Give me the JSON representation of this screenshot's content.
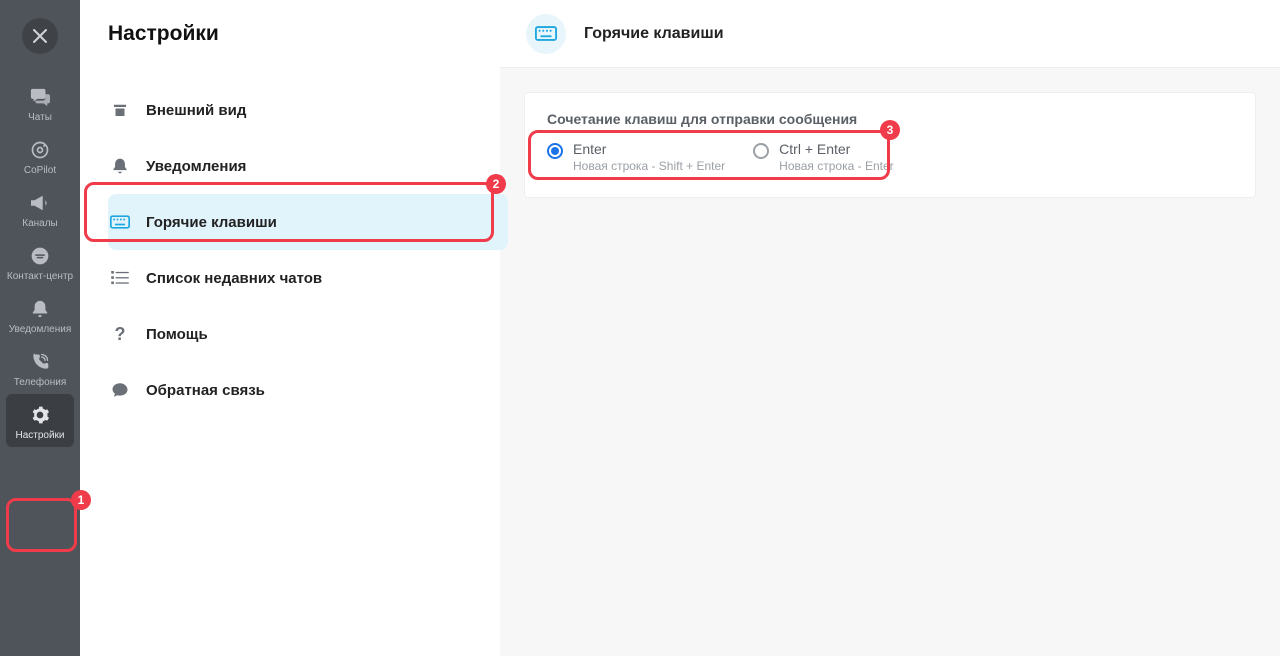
{
  "nav": {
    "items": [
      {
        "label": "Чаты"
      },
      {
        "label": "CoPilot"
      },
      {
        "label": "Каналы"
      },
      {
        "label": "Контакт-центр"
      },
      {
        "label": "Уведомления"
      },
      {
        "label": "Телефония"
      },
      {
        "label": "Настройки"
      }
    ]
  },
  "settings": {
    "title": "Настройки",
    "items": [
      {
        "label": "Внешний вид"
      },
      {
        "label": "Уведомления"
      },
      {
        "label": "Горячие клавиши"
      },
      {
        "label": "Список недавних чатов"
      },
      {
        "label": "Помощь"
      },
      {
        "label": "Обратная связь"
      }
    ]
  },
  "main": {
    "header_title": "Горячие клавиши",
    "section_title": "Сочетание клавиш для отправки сообщения",
    "options": [
      {
        "title": "Enter",
        "subtitle": "Новая строка - Shift + Enter",
        "checked": true
      },
      {
        "title": "Ctrl + Enter",
        "subtitle": "Новая строка - Enter",
        "checked": false
      }
    ]
  },
  "annotations": {
    "a1": "1",
    "a2": "2",
    "a3": "3"
  }
}
